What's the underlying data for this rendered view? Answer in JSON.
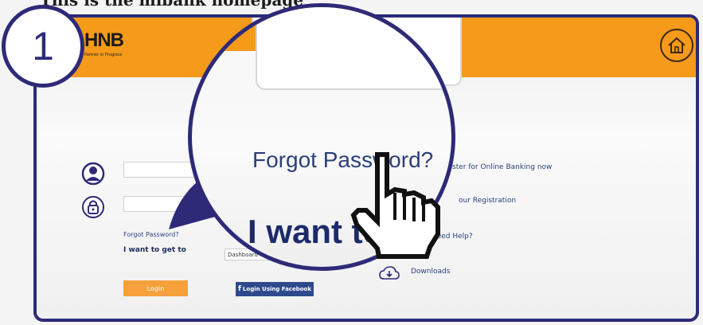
{
  "caption": "This is the mibank homepage",
  "step_number": "1",
  "header": {
    "logo_text": "HNB",
    "tagline": "Partner in Progress",
    "home_icon": "home-icon"
  },
  "login_form": {
    "username_icon": "user-icon",
    "password_icon": "lock-icon",
    "username_value": "",
    "password_value": "",
    "forgot_password": "Forgot Password?",
    "want_to_get_to": "I want to get to",
    "destination_selected": "Dashboard",
    "login_button": "Login",
    "facebook_button": "Login Using Facebook",
    "facebook_icon": "f"
  },
  "right_links": {
    "register": "ster for Online Banking now",
    "registration": "our Registration",
    "help": "Need Help?",
    "downloads": "Downloads",
    "downloads_icon": "cloud-download-icon"
  },
  "magnifier": {
    "forgot_password": "Forgot Password?",
    "want_to": "I want to",
    "cursor_icon": "hand-pointer-icon"
  },
  "colors": {
    "header": "#f69a1a",
    "frame_border": "#2e2a78",
    "link": "#2b3f7a",
    "login_button": "#f5a03a",
    "facebook_button": "#2f4a8c"
  }
}
